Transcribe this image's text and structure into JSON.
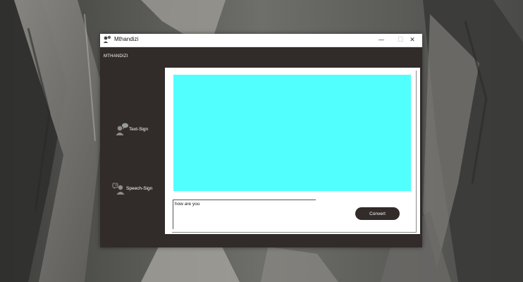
{
  "window": {
    "title": "Mthandizi",
    "icon": "person-sign-icon",
    "controls": {
      "minimize": "—",
      "maximize": "☐",
      "close": "✕"
    }
  },
  "app": {
    "header": "MTHANDIZI"
  },
  "sidebar": {
    "items": [
      {
        "label": "Text-Sign",
        "icon": "text-sign-icon"
      },
      {
        "label": "Speech-Sign",
        "icon": "speech-sign-icon"
      }
    ]
  },
  "main": {
    "display_color": "#52ffff",
    "input_value": "how are you",
    "convert_label": "Convert"
  },
  "colors": {
    "sidebar_bg": "#312b2a",
    "display_bg": "#52ffff",
    "button_bg": "#312b2a"
  }
}
